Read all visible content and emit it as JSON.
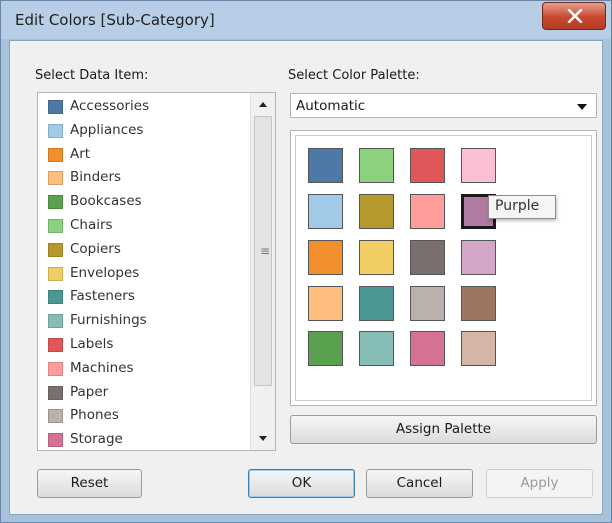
{
  "window": {
    "title": "Edit Colors [Sub-Category]"
  },
  "icons": {
    "close": "close-x-icon",
    "scroll_up": "triangle-up-icon",
    "scroll_down": "triangle-down-icon",
    "grip": "scroll-grip-icon",
    "dropdown": "triangle-down-icon"
  },
  "data_items": {
    "label": "Select Data Item:",
    "items": [
      {
        "label": "Accessories",
        "color": "#4e79a7"
      },
      {
        "label": "Appliances",
        "color": "#a0cbe8"
      },
      {
        "label": "Art",
        "color": "#f28e2b"
      },
      {
        "label": "Binders",
        "color": "#ffbe7d"
      },
      {
        "label": "Bookcases",
        "color": "#59a14f"
      },
      {
        "label": "Chairs",
        "color": "#8cd17d"
      },
      {
        "label": "Copiers",
        "color": "#b6992d"
      },
      {
        "label": "Envelopes",
        "color": "#f1ce63"
      },
      {
        "label": "Fasteners",
        "color": "#499894"
      },
      {
        "label": "Furnishings",
        "color": "#86bcb6"
      },
      {
        "label": "Labels",
        "color": "#e15759"
      },
      {
        "label": "Machines",
        "color": "#ff9d9a"
      },
      {
        "label": "Paper",
        "color": "#79706e"
      },
      {
        "label": "Phones",
        "color": "#bab0ac"
      },
      {
        "label": "Storage",
        "color": "#d37295"
      }
    ]
  },
  "palette": {
    "label": "Select Color Palette:",
    "selected": "Automatic",
    "swatches": [
      [
        "#4e79a7",
        "#8cd17d",
        "#e15759",
        "#fabfd2"
      ],
      [
        "#a0cbe8",
        "#b6992d",
        "#ff9d9a",
        "#b07aa1"
      ],
      [
        "#f28e2b",
        "#f1ce63",
        "#79706e",
        "#d4a6c8"
      ],
      [
        "#ffbe7d",
        "#499894",
        "#bab0ac",
        "#9d7660"
      ],
      [
        "#59a14f",
        "#86bcb6",
        "#d37295",
        "#d7b5a6"
      ]
    ],
    "selected_swatch_color": "#b07aa1",
    "tooltip": "Purple",
    "assign_label": "Assign Palette"
  },
  "buttons": {
    "reset": "Reset",
    "ok": "OK",
    "cancel": "Cancel",
    "apply": "Apply"
  }
}
